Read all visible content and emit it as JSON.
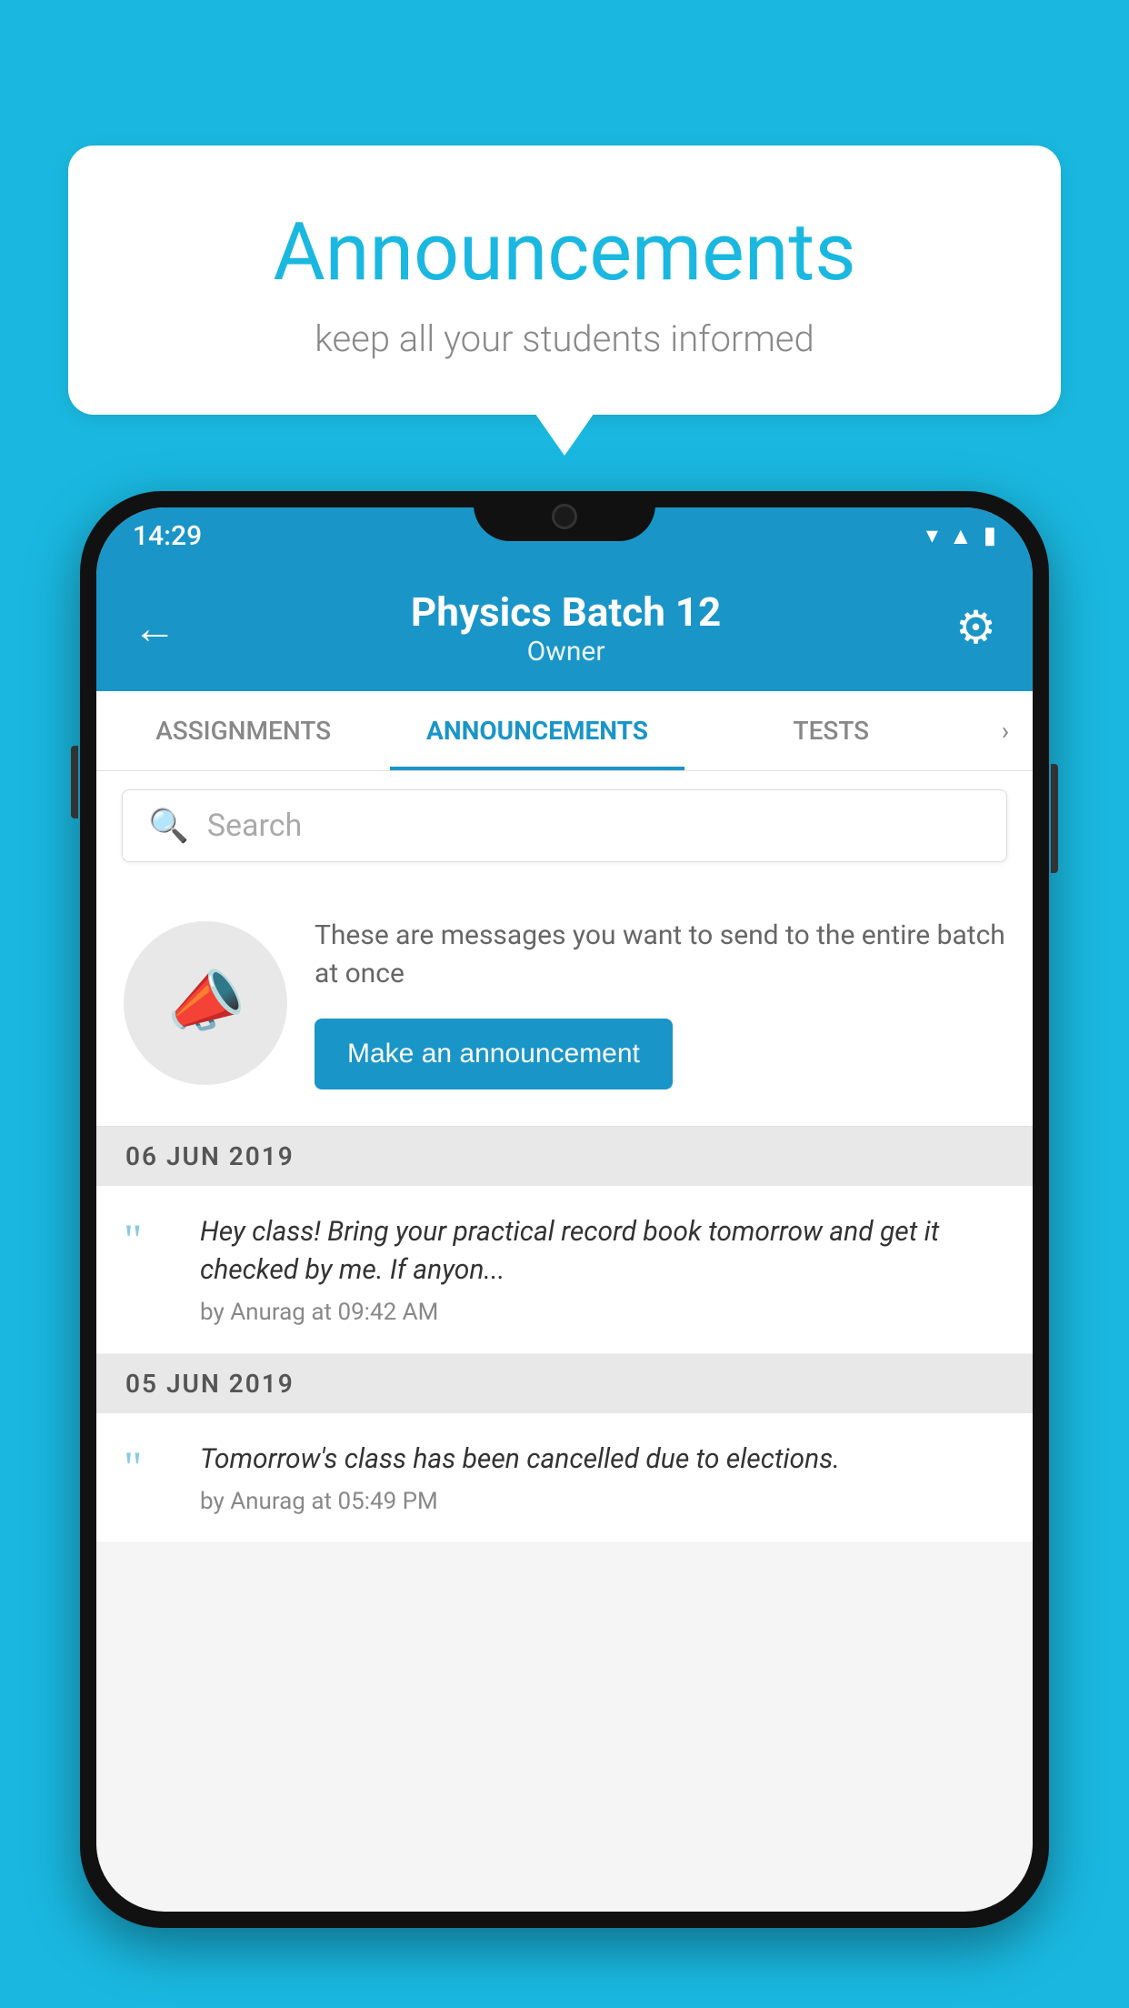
{
  "background_color": "#1ab8e0",
  "speech_bubble": {
    "title": "Announcements",
    "subtitle": "keep all your students informed"
  },
  "phone": {
    "status_bar": {
      "time": "14:29",
      "icons": [
        "wifi",
        "signal",
        "battery"
      ]
    },
    "header": {
      "title": "Physics Batch 12",
      "subtitle": "Owner",
      "back_label": "←",
      "gear_label": "⚙"
    },
    "tabs": [
      {
        "label": "ASSIGNMENTS",
        "active": false
      },
      {
        "label": "ANNOUNCEMENTS",
        "active": true
      },
      {
        "label": "TESTS",
        "active": false
      }
    ],
    "search": {
      "placeholder": "Search"
    },
    "promo": {
      "description": "These are messages you want to send to the entire batch at once",
      "button_label": "Make an announcement"
    },
    "announcements": [
      {
        "date": "06  JUN  2019",
        "text": "Hey class! Bring your practical record book tomorrow and get it checked by me. If anyon...",
        "author": "by Anurag at 09:42 AM"
      },
      {
        "date": "05  JUN  2019",
        "text": "Tomorrow's class has been cancelled due to elections.",
        "author": "by Anurag at 05:49 PM"
      }
    ]
  }
}
